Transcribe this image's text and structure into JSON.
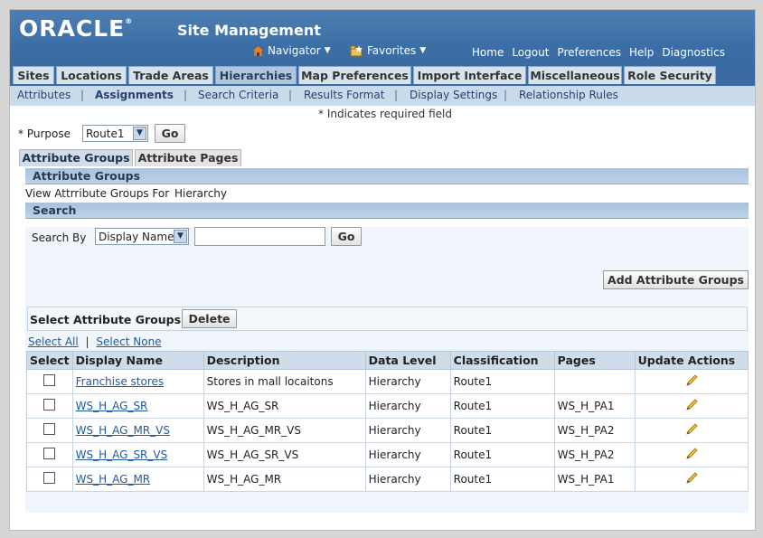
{
  "header": {
    "logo_text": "ORACLE",
    "app_title": "Site Management",
    "navigator_label": "Navigator",
    "favorites_label": "Favorites",
    "global_links": [
      "Home",
      "Logout",
      "Preferences",
      "Help",
      "Diagnostics"
    ]
  },
  "tabs": [
    "Sites",
    "Locations",
    "Trade Areas",
    "Hierarchies",
    "Map Preferences",
    "Import Interface",
    "Miscellaneous",
    "Role Security"
  ],
  "active_tab": "Hierarchies",
  "subnav": [
    "Attributes",
    "Assignments",
    "Search Criteria",
    "Results Format",
    "Display Settings",
    "Relationship Rules"
  ],
  "active_subnav": "Assignments",
  "required_note": "* Indicates required field",
  "purpose": {
    "label": "* Purpose",
    "value": "Route1",
    "go": "Go"
  },
  "subtabs": [
    "Attribute Groups",
    "Attribute Pages"
  ],
  "section_title": "Attribute Groups",
  "view_for_label": "View Attrribute Groups For",
  "view_for_value": "Hierarchy",
  "search": {
    "title": "Search",
    "search_by_label": "Search By",
    "search_by_value": "Display Name",
    "input_value": "",
    "go": "Go"
  },
  "add_button": "Add Attribute Groups",
  "select_bar": {
    "label": "Select Attribute Groups:",
    "delete": "Delete"
  },
  "select_all": "Select All",
  "select_none": "Select None",
  "columns": [
    "Select",
    "Display Name",
    "Description",
    "Data Level",
    "Classification",
    "Pages",
    "Update Actions"
  ],
  "rows": [
    {
      "name": "Franchise stores",
      "description": "Stores in mall locaitons",
      "level": "Hierarchy",
      "classification": "Route1",
      "pages": ""
    },
    {
      "name": "WS_H_AG_SR",
      "description": "WS_H_AG_SR",
      "level": "Hierarchy",
      "classification": "Route1",
      "pages": "WS_H_PA1"
    },
    {
      "name": "WS_H_AG_MR_VS",
      "description": "WS_H_AG_MR_VS",
      "level": "Hierarchy",
      "classification": "Route1",
      "pages": "WS_H_PA2"
    },
    {
      "name": "WS_H_AG_SR_VS",
      "description": "WS_H_AG_SR_VS",
      "level": "Hierarchy",
      "classification": "Route1",
      "pages": "WS_H_PA2"
    },
    {
      "name": "WS_H_AG_MR",
      "description": "WS_H_AG_MR",
      "level": "Hierarchy",
      "classification": "Route1",
      "pages": "WS_H_PA1"
    }
  ],
  "colors": {
    "brand_blue": "#3c6fa6",
    "link": "#1e5ba1",
    "tab_bg": "#d6e2ee"
  }
}
